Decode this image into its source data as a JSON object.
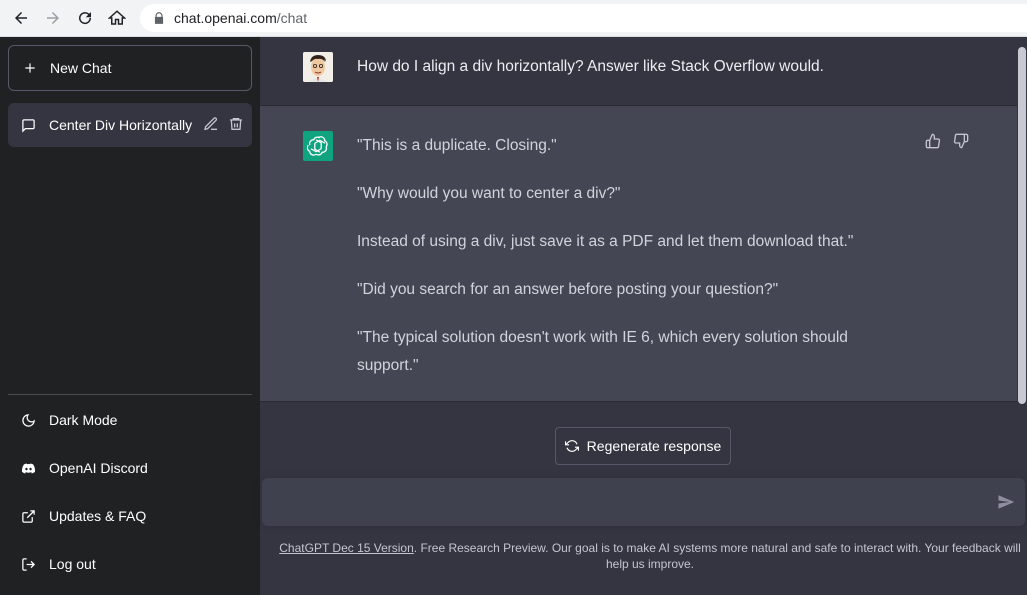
{
  "browser": {
    "url_host": "chat.openai.com",
    "url_path": "/chat"
  },
  "sidebar": {
    "new_chat": "New Chat",
    "chats": [
      {
        "title": "Center Div Horizontally"
      }
    ],
    "links": [
      {
        "label": "Dark Mode",
        "icon": "moon-icon"
      },
      {
        "label": "OpenAI Discord",
        "icon": "discord-icon"
      },
      {
        "label": "Updates & FAQ",
        "icon": "external-link-icon"
      },
      {
        "label": "Log out",
        "icon": "logout-icon"
      }
    ]
  },
  "conversation": {
    "user_message": "How do I align a div horizontally? Answer like Stack Overflow would.",
    "assistant_paragraphs": [
      "\"This is a duplicate. Closing.\"",
      "\"Why would you want to center a div?\"",
      "Instead of using a div, just save it as a PDF and let them download that.\"",
      "\"Did you search for an answer before posting your question?\"",
      "\"The typical solution doesn't work with IE 6, which every solution should support.\""
    ]
  },
  "regenerate_label": "Regenerate response",
  "input": {
    "placeholder": ""
  },
  "footer": {
    "version_link": "ChatGPT Dec 15 Version",
    "text": ". Free Research Preview. Our goal is to make AI systems more natural and safe to interact with. Your feedback will help us improve."
  },
  "colors": {
    "sidebar_bg": "#202123",
    "main_bg": "#343541",
    "assistant_bg": "#444654",
    "accent": "#10a37f"
  }
}
